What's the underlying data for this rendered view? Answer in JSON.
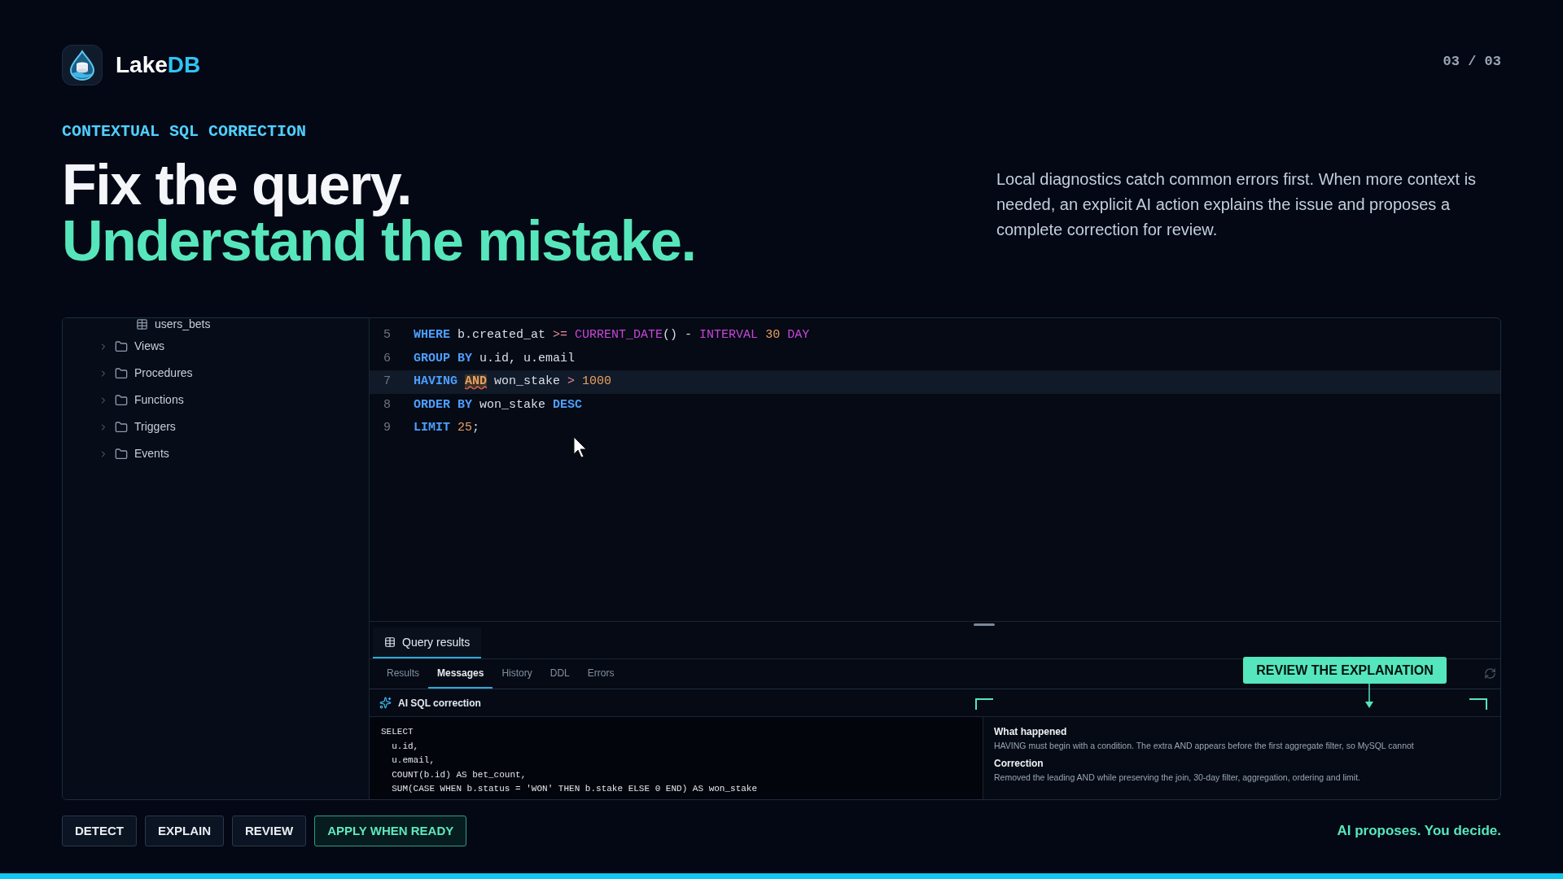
{
  "brand": {
    "name": "Lake",
    "accent": "DB"
  },
  "page_counter": "03 / 03",
  "eyebrow": "CONTEXTUAL SQL CORRECTION",
  "headline": {
    "line1": "Fix the query.",
    "line2": "Understand the mistake."
  },
  "intro": "Local diagnostics catch common errors first. When more context is needed, an explicit AI action explains the issue and proposes a complete correction for review.",
  "sidebar": {
    "items": [
      {
        "label": "users_bets",
        "kind": "table"
      },
      {
        "label": "Views",
        "kind": "folder",
        "expanded": false
      },
      {
        "label": "Procedures",
        "kind": "folder",
        "expanded": false
      },
      {
        "label": "Functions",
        "kind": "folder",
        "expanded": false
      },
      {
        "label": "Triggers",
        "kind": "folder",
        "expanded": false
      },
      {
        "label": "Events",
        "kind": "folder",
        "expanded": false
      }
    ]
  },
  "editor": {
    "lines": [
      {
        "number": "5",
        "active": false,
        "tokens": [
          {
            "text": "WHERE",
            "kind": "kw"
          },
          {
            "text": " b.created_at ",
            "kind": "text"
          },
          {
            "text": ">=",
            "kind": "op"
          },
          {
            "text": " CURRENT_DATE",
            "kind": "fn"
          },
          {
            "text": "() - ",
            "kind": "text"
          },
          {
            "text": "INTERVAL",
            "kind": "fn"
          },
          {
            "text": " 30",
            "kind": "num"
          },
          {
            "text": " DAY",
            "kind": "fn"
          }
        ]
      },
      {
        "number": "6",
        "active": false,
        "tokens": [
          {
            "text": "GROUP BY",
            "kind": "kw"
          },
          {
            "text": " u.id, u.email",
            "kind": "text"
          }
        ]
      },
      {
        "number": "7",
        "active": true,
        "tokens": [
          {
            "text": "HAVING ",
            "kind": "kw"
          },
          {
            "text": "AND",
            "kind": "error"
          },
          {
            "text": " won_stake ",
            "kind": "text"
          },
          {
            "text": ">",
            "kind": "op"
          },
          {
            "text": " 1000",
            "kind": "num"
          }
        ]
      },
      {
        "number": "8",
        "active": false,
        "tokens": [
          {
            "text": "ORDER BY",
            "kind": "kw"
          },
          {
            "text": " won_stake ",
            "kind": "text"
          },
          {
            "text": "DESC",
            "kind": "kw"
          }
        ]
      },
      {
        "number": "9",
        "active": false,
        "tokens": [
          {
            "text": "LIMIT ",
            "kind": "kw"
          },
          {
            "text": "25",
            "kind": "num"
          },
          {
            "text": ";",
            "kind": "text"
          }
        ]
      }
    ]
  },
  "results_panel": {
    "tabs": [
      {
        "label": "Query results",
        "selected": true
      }
    ],
    "subtabs": [
      {
        "label": "Results",
        "selected": false
      },
      {
        "label": "Messages",
        "selected": true
      },
      {
        "label": "History",
        "selected": false
      },
      {
        "label": "DDL",
        "selected": false
      },
      {
        "label": "Errors",
        "selected": false
      }
    ],
    "correction_title": "AI SQL correction",
    "corrected_sql": [
      "SELECT",
      "  u.id,",
      "  u.email,",
      "  COUNT(b.id) AS bet_count,",
      "  SUM(CASE WHEN b.status = 'WON' THEN b.stake ELSE 0 END) AS won_stake"
    ],
    "explanation": [
      {
        "heading": "What happened",
        "body": "HAVING must begin with a condition. The extra AND appears before the first aggregate filter, so MySQL cannot"
      },
      {
        "heading": "Correction",
        "body": "Removed the leading AND while preserving the join, 30-day filter, aggregation, ordering and limit."
      }
    ]
  },
  "callout": "REVIEW THE EXPLANATION",
  "steps": [
    {
      "label": "DETECT",
      "selected": false
    },
    {
      "label": "EXPLAIN",
      "selected": false
    },
    {
      "label": "REVIEW",
      "selected": false
    },
    {
      "label": "APPLY WHEN READY",
      "selected": true
    }
  ],
  "tagline": "AI proposes. You decide."
}
